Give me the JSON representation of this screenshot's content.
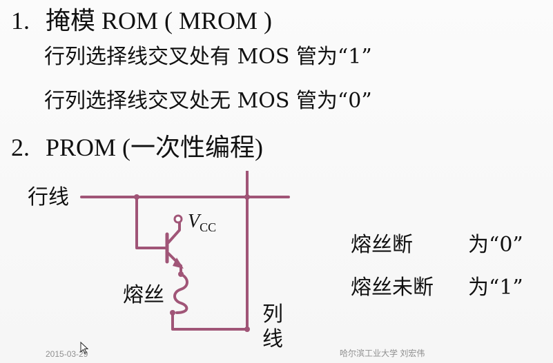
{
  "item1": {
    "number": "1.",
    "title": "掩模 ROM ( MROM )",
    "line1": "行列选择线交叉处有 MOS 管为“1”",
    "line2": "行列选择线交叉处无 MOS 管为“0”"
  },
  "item2": {
    "number": "2.",
    "title": "PROM (一次性编程)"
  },
  "diagram": {
    "row_line_label": "行线",
    "vcc_label": "V",
    "vcc_sub": "CC",
    "fuse_label": "熔丝",
    "col_line_label_1": "列",
    "col_line_label_2": "线",
    "wire_color": "#a05577"
  },
  "rules": [
    {
      "text": "熔丝断",
      "value": "为“0”"
    },
    {
      "text": "熔丝未断",
      "value": "为“1”"
    }
  ],
  "footer": {
    "date": "2015-03-29",
    "author": "哈尔滨工业大学 刘宏伟"
  }
}
